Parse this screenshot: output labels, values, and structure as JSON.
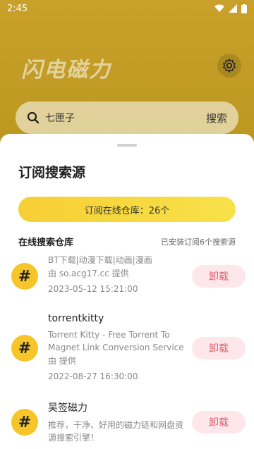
{
  "status": {
    "time": "2:45"
  },
  "app": {
    "title": "闪电磁力"
  },
  "search": {
    "query": "七匣子",
    "button": "搜索"
  },
  "sheet": {
    "title": "订阅搜索源",
    "count_label": "订阅在线仓库：26个",
    "section_title": "在线搜索仓库",
    "installed_note": "已安装订阅6个搜索源"
  },
  "sources": [
    {
      "name": "",
      "desc": "BT下载|动漫下载|动画|漫画",
      "by": "由 so.acg17.cc 提供",
      "date": "2023-05-12 15:21:00",
      "action": "卸载"
    },
    {
      "name": "torrentkitty",
      "desc": "Torrent Kitty - Free Torrent To Magnet Link Conversion Service",
      "by": "由  提供",
      "date": "2022-08-27 16:30:00",
      "action": "卸载"
    },
    {
      "name": "吴签磁力",
      "desc": "推荐，干净、好用的磁力链和网盘资源搜索引擎！",
      "by": "",
      "date": "",
      "action": "卸载"
    }
  ],
  "badge_symbol": "#",
  "colors": {
    "accent": "#f6c52a",
    "danger": "#e0606f"
  }
}
